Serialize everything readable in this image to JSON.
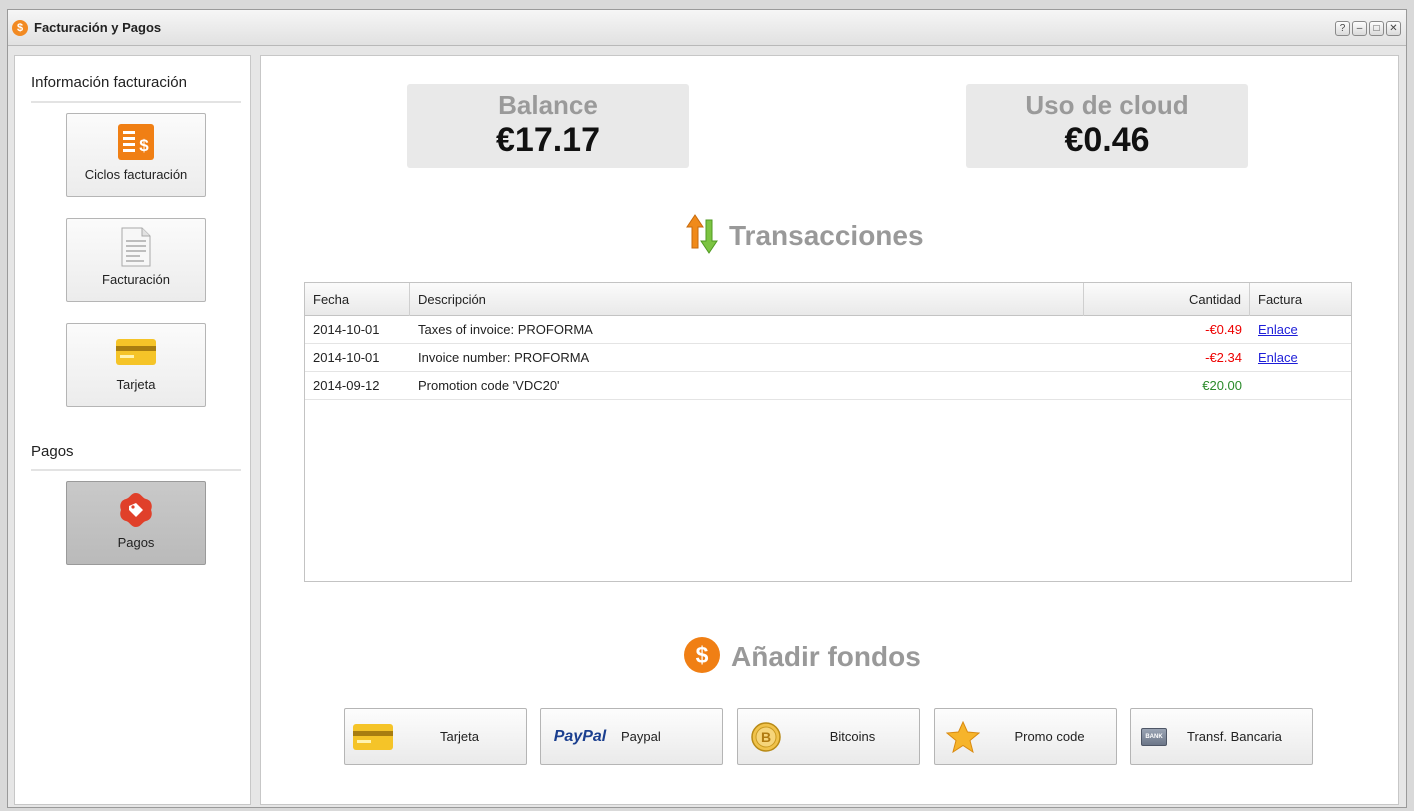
{
  "window": {
    "title": "Facturación y Pagos",
    "controls": [
      "?",
      "–",
      "□",
      "✕"
    ]
  },
  "sidebar": {
    "section_billing": "Información facturación",
    "section_payments": "Pagos",
    "items": [
      {
        "label": "Ciclos facturación",
        "icon": "billing-cycles-icon"
      },
      {
        "label": "Facturación",
        "icon": "invoice-document-icon"
      },
      {
        "label": "Tarjeta",
        "icon": "credit-card-icon"
      },
      {
        "label": "Pagos",
        "icon": "payments-tag-icon",
        "active": true
      }
    ]
  },
  "stats": {
    "balance_label": "Balance",
    "balance_value": "€17.17",
    "cloud_label": "Uso de cloud",
    "cloud_value": "€0.46"
  },
  "transactions": {
    "heading": "Transacciones",
    "icon": "transactions-arrows-icon",
    "columns": [
      "Fecha",
      "Descripción",
      "Cantidad",
      "Factura"
    ],
    "rows": [
      {
        "date": "2014-10-01",
        "description": "Taxes of invoice: PROFORMA",
        "amount": "-€0.49",
        "invoice": "Enlace",
        "type": "negative"
      },
      {
        "date": "2014-10-01",
        "description": "Invoice number: PROFORMA",
        "amount": "-€2.34",
        "invoice": "Enlace",
        "type": "negative"
      },
      {
        "date": "2014-09-12",
        "description": "Promotion code 'VDC20'",
        "amount": "€20.00",
        "invoice": "",
        "type": "positive"
      }
    ]
  },
  "add_funds": {
    "heading": "Añadir fondos",
    "icon": "dollar-circle-icon",
    "buttons": [
      {
        "label": "Tarjeta",
        "icon": "credit-card-icon"
      },
      {
        "label": "Paypal",
        "icon": "paypal-logo",
        "logo_text": "PayPal"
      },
      {
        "label": "Bitcoins",
        "icon": "bitcoin-coin-icon"
      },
      {
        "label": "Promo code",
        "icon": "star-icon"
      },
      {
        "label": "Transf. Bancaria",
        "icon": "bank-icon",
        "icon_text": "BANK"
      }
    ]
  },
  "colors": {
    "accent_orange": "#f28a22",
    "negative": "#ee0000",
    "positive": "#2a8a2a",
    "link": "#1d1dd8"
  }
}
